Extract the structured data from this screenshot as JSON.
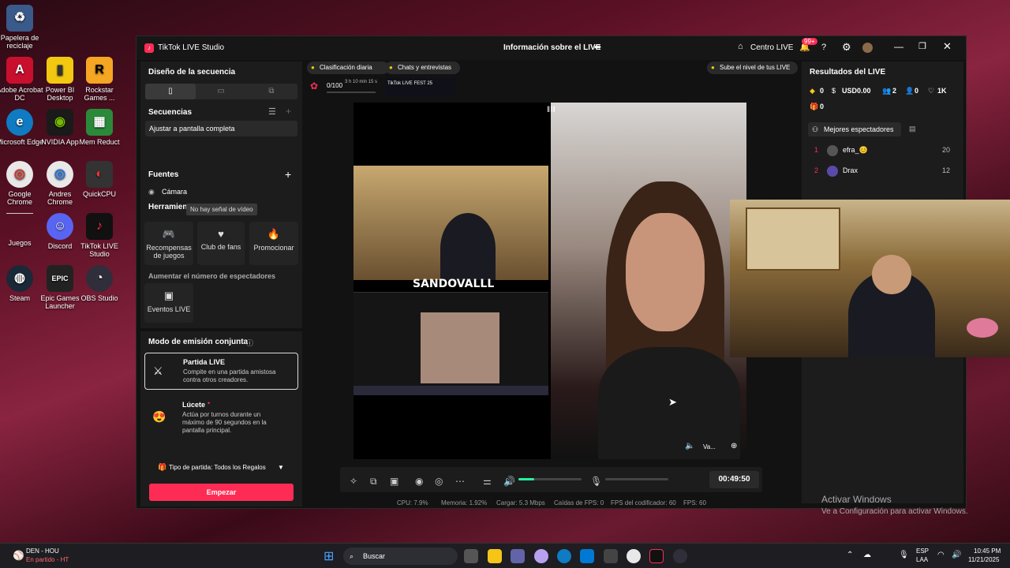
{
  "desktop": {
    "icons": [
      {
        "label": "Papelera de reciclaje",
        "glyph": "♻"
      },
      {
        "label": "Adobe Acrobat DC",
        "glyph": "A"
      },
      {
        "label": "Power BI Desktop",
        "glyph": "▮"
      },
      {
        "label": "Rockstar Games ...",
        "glyph": "R"
      },
      {
        "label": "Microsoft Edge",
        "glyph": "e"
      },
      {
        "label": "NVIDIA App",
        "glyph": "◉"
      },
      {
        "label": "Mem Reduct",
        "glyph": "▦"
      },
      {
        "label": "Google Chrome",
        "glyph": "◎"
      },
      {
        "label": "Andres Chrome",
        "glyph": "◎"
      },
      {
        "label": "QuickCPU",
        "glyph": "◐"
      },
      {
        "label": "Juegos",
        "glyph": ""
      },
      {
        "label": "Discord",
        "glyph": "☺"
      },
      {
        "label": "TikTok LIVE Studio",
        "glyph": "♪"
      },
      {
        "label": "Steam",
        "glyph": "◍"
      },
      {
        "label": "Epic Games Launcher",
        "glyph": "EPIC"
      },
      {
        "label": "OBS Studio",
        "glyph": "◔"
      }
    ],
    "watermark_title": "Activar Windows",
    "watermark_sub": "Ve a Configuración para activar Windows."
  },
  "window": {
    "app_title": "TikTok LIVE Studio",
    "center_title": "Información sobre el LIVE",
    "centro_live": "Centro LIVE",
    "badge": "99+"
  },
  "left": {
    "layout_title": "Diseño de la secuencia",
    "sequences_title": "Secuencias",
    "sequence_item": "Ajustar a pantalla completa",
    "sources_title": "Fuentes",
    "camera": "Cámara",
    "tools_title": "Herramien",
    "tooltip": "No hay señal de vídeo",
    "tools": [
      {
        "label": "Recompensas de juegos",
        "glyph": "🎮"
      },
      {
        "label": "Club de fans",
        "glyph": "♥"
      },
      {
        "label": "Promocionar",
        "glyph": "🔥"
      }
    ],
    "increase_title": "Aumentar el número de espectadores",
    "events": "Eventos LIVE",
    "coop_title": "Modo de emisión conjunta",
    "mode1_title": "Partida LIVE",
    "mode1_desc": "Compite en una partida amistosa contra otros creadores.",
    "mode2_title": "Lúcete",
    "mode2_desc": "Actúa por turnos durante un máximo de 90 segundos en la pantalla principal.",
    "match_type": "Tipo de partida: Todos los Regalos",
    "start": "Empezar"
  },
  "center": {
    "chip1": "Clasificación diaria",
    "chip2": "Chats y entrevistas",
    "chip3": "Sube el nivel de tus LIVE",
    "progress": "0/100",
    "timer_small": "3 h 10 min 15 s",
    "fest": "TikTok LIVE FEST 25",
    "overlay_name": "SANDOVALLL",
    "guest": "Va...",
    "elapsed": "00:49:50",
    "volume_level": 0.25
  },
  "stats": {
    "cpu": "CPU: 7.9%",
    "mem": "Memoria: 1.92%",
    "upload": "Cargar: 5.3 Mbps",
    "fps_drop": "Caídas de FPS: 0",
    "enc_fps": "FPS del codificador: 60",
    "fps": "FPS: 60"
  },
  "right": {
    "title": "Resultados del LIVE",
    "diamonds": "0",
    "usd": "USD0.00",
    "viewers": "2",
    "new_followers": "0",
    "likes": "1K",
    "gifts": "0",
    "top_title": "Mejores espectadores",
    "viewers_list": [
      {
        "rank": "1",
        "name": "efra_😊",
        "score": "20"
      },
      {
        "rank": "2",
        "name": "Drax",
        "score": "12"
      }
    ]
  },
  "taskbar": {
    "weather_title": "DEN - HOU",
    "weather_sub": "En partido - HT",
    "search": "Buscar",
    "lang1": "ESP",
    "lang2": "LAA",
    "time": "10:45 PM",
    "date": "11/21/2025"
  },
  "colors": {
    "accent": "#fe2c55",
    "panel": "#1c1c1c"
  }
}
